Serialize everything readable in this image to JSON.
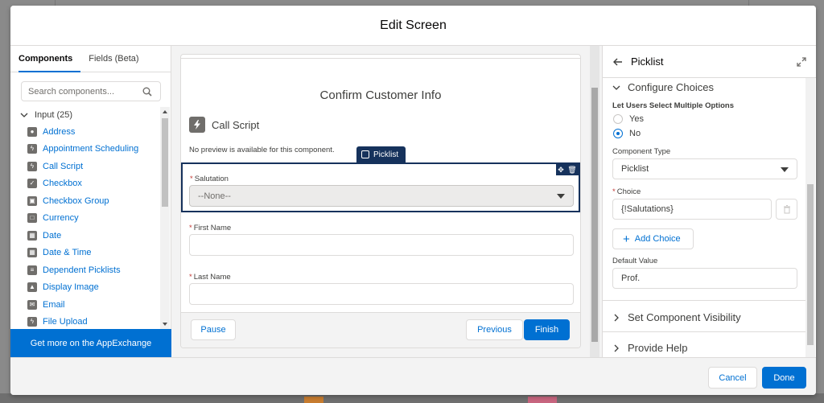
{
  "modal": {
    "title": "Edit Screen"
  },
  "left_panel": {
    "tabs": [
      {
        "label": "Components",
        "active": true
      },
      {
        "label": "Fields (Beta)",
        "active": false
      }
    ],
    "search": {
      "placeholder": "Search components..."
    },
    "group": {
      "label": "Input (25)"
    },
    "items": [
      {
        "label": "Address",
        "icon": "location-icon"
      },
      {
        "label": "Appointment Scheduling",
        "icon": "lightning-icon"
      },
      {
        "label": "Call Script",
        "icon": "lightning-icon"
      },
      {
        "label": "Checkbox",
        "icon": "checkbox-icon"
      },
      {
        "label": "Checkbox Group",
        "icon": "checkbox-group-icon"
      },
      {
        "label": "Currency",
        "icon": "currency-icon"
      },
      {
        "label": "Date",
        "icon": "calendar-icon"
      },
      {
        "label": "Date & Time",
        "icon": "calendar-time-icon"
      },
      {
        "label": "Dependent Picklists",
        "icon": "list-icon"
      },
      {
        "label": "Display Image",
        "icon": "image-icon"
      },
      {
        "label": "Email",
        "icon": "email-icon"
      },
      {
        "label": "File Upload",
        "icon": "lightning-icon"
      }
    ],
    "appexchange_label": "Get more on the AppExchange"
  },
  "canvas": {
    "screen_title": "Confirm Customer Info",
    "call_script_label": "Call Script",
    "no_preview_text": "No preview is available for this component.",
    "selected_badge": "Picklist",
    "fields": {
      "salutation": {
        "label": "Salutation",
        "value": "--None--",
        "required_mark": "*"
      },
      "first_name": {
        "label": "First Name",
        "required_mark": "*"
      },
      "last_name": {
        "label": "Last Name",
        "required_mark": "*"
      }
    },
    "buttons": {
      "pause": "Pause",
      "previous": "Previous",
      "finish": "Finish"
    }
  },
  "right_panel": {
    "title": "Picklist",
    "configure_section": "Configure Choices",
    "multi_select": {
      "label": "Let Users Select Multiple Options",
      "options": [
        {
          "label": "Yes",
          "selected": false
        },
        {
          "label": "No",
          "selected": true
        }
      ]
    },
    "component_type": {
      "label": "Component Type",
      "value": "Picklist"
    },
    "choice": {
      "label": "Choice",
      "value": "{!Salutations}",
      "required_mark": "*"
    },
    "add_choice_label": "Add Choice",
    "default_value": {
      "label": "Default Value",
      "value": "Prof."
    },
    "visibility_section": "Set Component Visibility",
    "help_section": "Provide Help"
  },
  "footer": {
    "cancel": "Cancel",
    "done": "Done"
  },
  "colors": {
    "brand": "#0070d2",
    "selected_outline": "#16325c",
    "required": "#c23934"
  }
}
